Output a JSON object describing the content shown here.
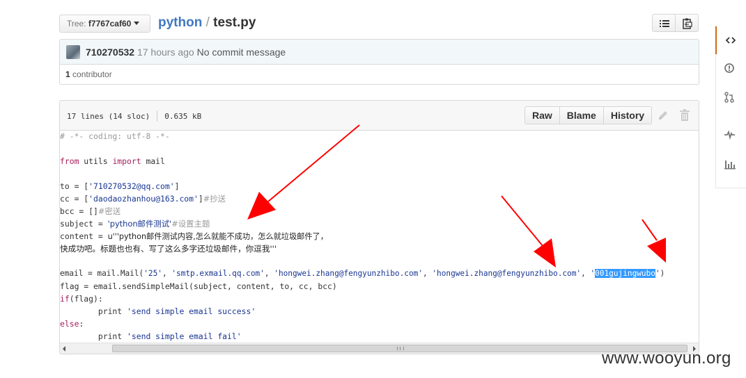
{
  "branch": {
    "prefix": "Tree:",
    "sha": "f7767caf60"
  },
  "breadcrumb": {
    "repo": "python",
    "separator": "/",
    "file": "test.py"
  },
  "header_buttons": {
    "list_icon": "list-unordered-icon",
    "clipboard_icon": "clippy-icon"
  },
  "commit": {
    "author": "710270532",
    "time": "17 hours ago",
    "message": "No commit message",
    "contributors_count": "1",
    "contributors_label": "contributor"
  },
  "file": {
    "lines": "17 lines (14 sloc)",
    "size": "0.635 kB",
    "actions": {
      "raw": "Raw",
      "blame": "Blame",
      "history": "History"
    }
  },
  "code": {
    "line1": "# -*- coding: utf-8 -*-",
    "l3_from": "from",
    "l3_mod": " utils ",
    "l3_import": "import",
    "l3_rest": " mail",
    "l5_pre": "to = [",
    "l5_str": "'710270532@qq.com'",
    "l5_post": "]",
    "l6_pre": "cc = [",
    "l6_str": "'daodaozhanhou@163.com'",
    "l6_post": "]",
    "l6_cmt": "#抄送",
    "l7_pre": "bcc = []",
    "l7_cmt": "#密送",
    "l8_pre": "subject = ",
    "l8_str": "'python邮件测试'",
    "l8_cmt": "#设置主题",
    "l9_pre": "content = ",
    "l9_str": "u'''python邮件测试内容,怎么就能不成功，怎么就垃圾邮件了，",
    "l10_str": "快成功吧。标题也也有、写了这么多字还垃圾邮件，你逗我'''",
    "l12_pre": "email = mail.Mail(",
    "l12_s1": "'25'",
    "l12_c1": ", ",
    "l12_s2": "'smtp.exmail.qq.com'",
    "l12_c2": ", ",
    "l12_s3": "'hongwei.zhang@fengyunzhibo.com'",
    "l12_c3": ", ",
    "l12_s4": "'hongwei.zhang@fengyunzhibo.com'",
    "l12_c4": ", ",
    "l12_q1": "'",
    "l12_sel": "001gujingwubo",
    "l12_q2": "'",
    "l12_post": ")",
    "l13": "flag = email.sendSimpleMail(subject, content, to, cc, bcc)",
    "l14_kw": "if",
    "l14_rest": "(flag):",
    "l15_pre": "        print ",
    "l15_str": "'send simple email success'",
    "l16_kw": "else",
    "l16_rest": ":",
    "l17_pre": "        print ",
    "l17_str": "'send simple email fail'"
  },
  "side_nav": [
    "code-icon",
    "issue-opened-icon",
    "git-pull-request-icon",
    "pulse-icon",
    "graph-icon"
  ],
  "watermark": "www.wooyun.org",
  "colors": {
    "link": "#4078c0",
    "keyword": "#a71d5d",
    "string": "#183691",
    "comment": "#999999",
    "selection": "#3399ff",
    "annotation_arrow": "#ff0000"
  }
}
